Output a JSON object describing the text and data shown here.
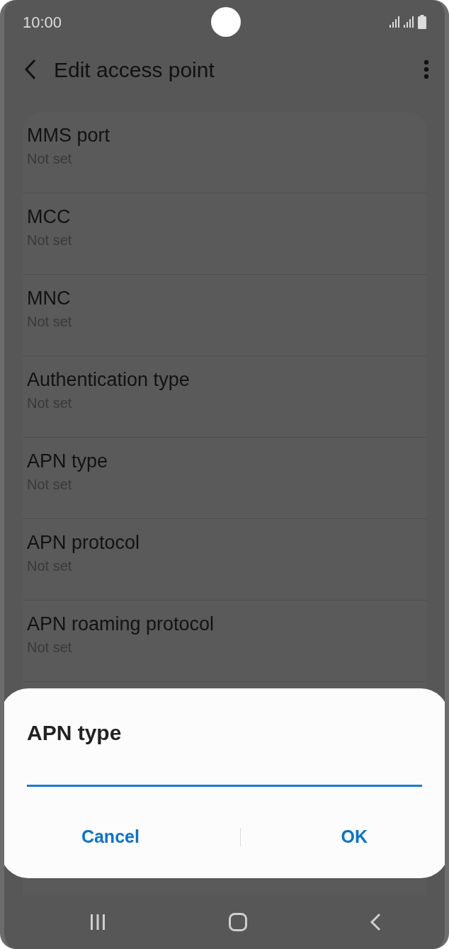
{
  "status_bar": {
    "time": "10:00"
  },
  "header": {
    "title": "Edit access point"
  },
  "settings": [
    {
      "title": "MMS port",
      "value": "Not set"
    },
    {
      "title": "MCC",
      "value": "Not set"
    },
    {
      "title": "MNC",
      "value": "Not set"
    },
    {
      "title": "Authentication type",
      "value": "Not set"
    },
    {
      "title": "APN type",
      "value": "Not set"
    },
    {
      "title": "APN protocol",
      "value": "Not set"
    },
    {
      "title": "APN roaming protocol",
      "value": "Not set"
    }
  ],
  "dialog": {
    "title": "APN type",
    "buttons": [
      "Cancel",
      "OK"
    ]
  }
}
